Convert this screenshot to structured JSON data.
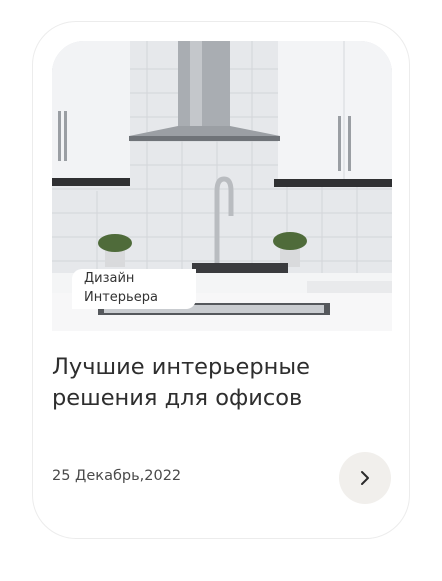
{
  "card": {
    "tag": {
      "line1": "Дизайн",
      "line2": "Интерьера"
    },
    "title": "Лучшие интерьерные решения для офисов",
    "date": "25 Декабрь,2022",
    "next_icon": "chevron-right-icon"
  },
  "colors": {
    "button_bg": "#f1efec",
    "text": "#2e2e2e"
  }
}
